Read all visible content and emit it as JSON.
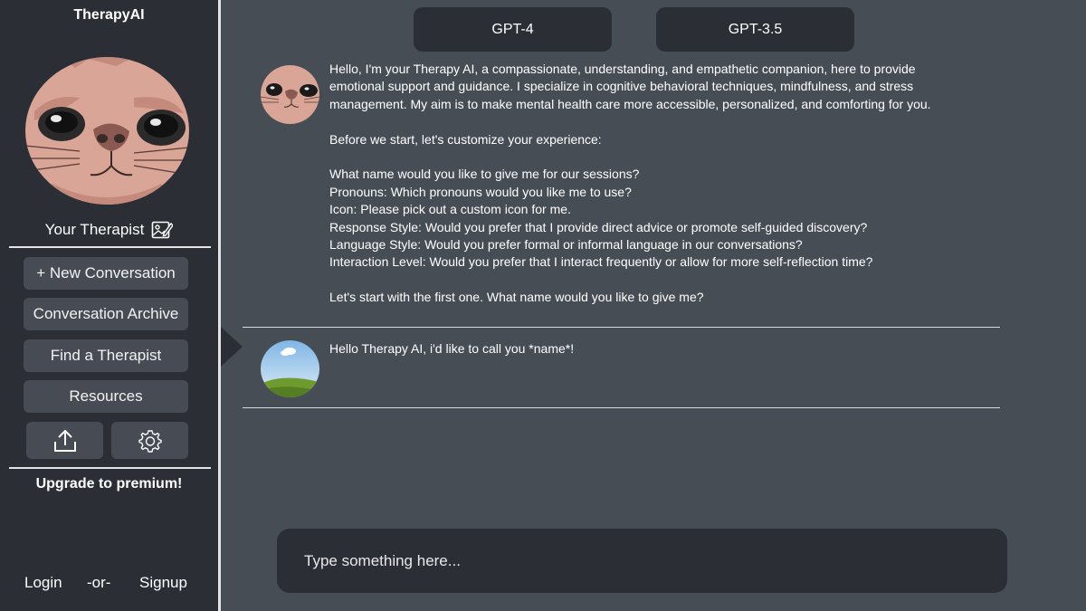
{
  "app": {
    "title": "TherapyAI"
  },
  "sidebar": {
    "therapist_label": "Your Therapist",
    "menu": [
      {
        "label": "+ New Conversation"
      },
      {
        "label": "Conversation Archive"
      },
      {
        "label": "Find a Therapist"
      },
      {
        "label": "Resources"
      }
    ],
    "icons": {
      "export": "upload-icon",
      "settings": "gear-icon",
      "edit": "edit-image-icon"
    },
    "upgrade_label": "Upgrade to premium!",
    "auth": {
      "login": "Login",
      "separator": "-or-",
      "signup": "Signup"
    }
  },
  "models": [
    {
      "label": "GPT-4"
    },
    {
      "label": "GPT-3.5"
    }
  ],
  "messages": [
    {
      "sender": "assistant",
      "avatar_icon": "cat-avatar",
      "text": "Hello, I'm your Therapy AI, a compassionate, understanding, and empathetic companion, here to provide\nemotional support and guidance. I specialize in cognitive behavioral techniques, mindfulness, and stress\nmanagement. My aim is to make mental health care more accessible, personalized, and comforting for you.\n\nBefore we start, let's customize your experience:\n\nWhat name would you like to give me for our sessions?\nPronouns: Which pronouns would you like me to use?\nIcon: Please pick out a custom icon for me.\nResponse Style: Would you prefer that I provide direct advice or promote self-guided discovery?\nLanguage Style: Would you prefer formal or informal language in our conversations?\nInteraction Level: Would you prefer that I interact frequently or allow for more self-reflection time?\n\nLet's start with the first one. What name would you like to give me?"
    },
    {
      "sender": "user",
      "avatar_icon": "landscape-avatar",
      "text": "Hello Therapy AI, i'd like to call you *name*!"
    }
  ],
  "input": {
    "placeholder": "Type something here..."
  },
  "colors": {
    "sidebar": "#2b2f35",
    "main": "#474d55",
    "button": "#474c54",
    "divider": "#e4e4e4"
  }
}
